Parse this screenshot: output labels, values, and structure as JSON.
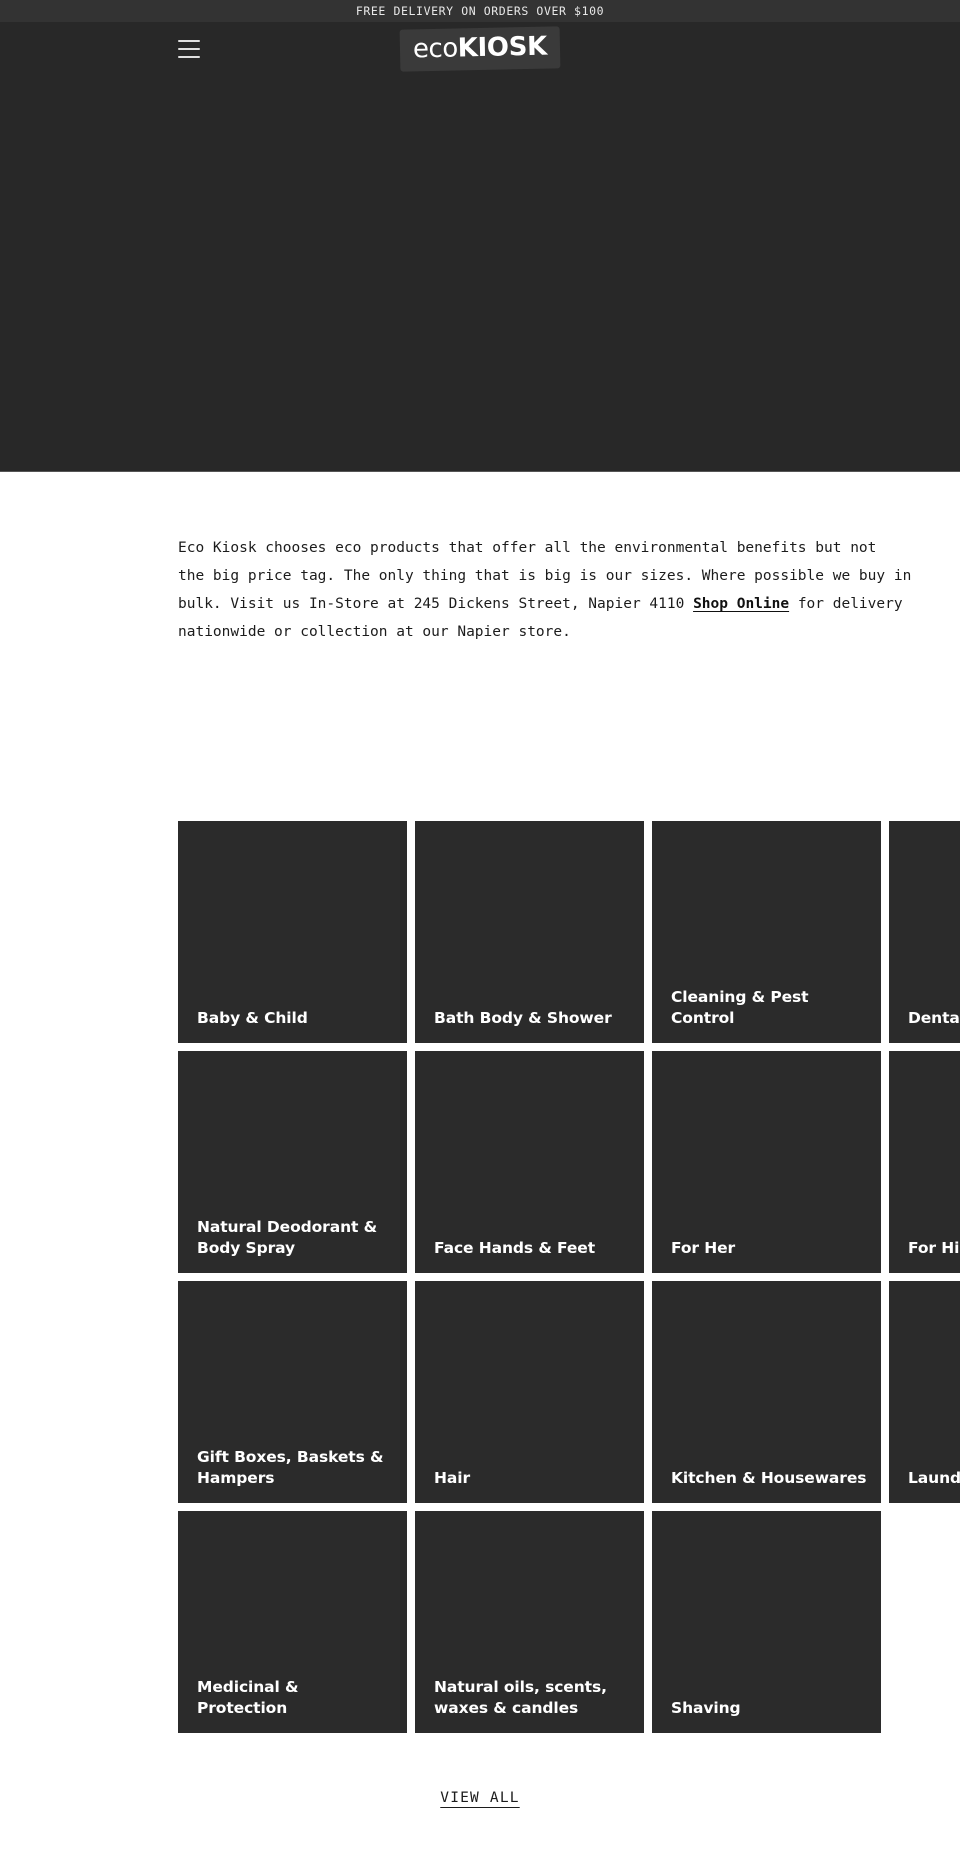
{
  "announcement": {
    "text": "FREE DELIVERY ON ORDERS OVER $100"
  },
  "header": {
    "menu_icon": "hamburger-menu-icon",
    "logo": {
      "part1": "eco",
      "part2": "KIOSK"
    }
  },
  "intro": {
    "line1": "Eco Kiosk chooses eco products that offer all the environmental benefits but not",
    "line2": "the big price tag. The only thing that is big is our sizes. Where possible we buy in",
    "line3_a": "bulk. Visit us In-Store at 245 Dickens Street, Napier 4110 ",
    "link": "Shop Online",
    "line3_b": " for delivery",
    "line4": "nationwide or collection at our Napier store."
  },
  "categories": [
    {
      "label": "Baby & Child"
    },
    {
      "label": "Bath Body & Shower"
    },
    {
      "label": "Cleaning & Pest Control"
    },
    {
      "label": "Dental Care"
    },
    {
      "label": "Natural Deodorant & Body Spray"
    },
    {
      "label": "Face Hands & Feet"
    },
    {
      "label": "For Her"
    },
    {
      "label": "For Him"
    },
    {
      "label": "Gift Boxes, Baskets & Hampers"
    },
    {
      "label": "Hair"
    },
    {
      "label": "Kitchen & Housewares"
    },
    {
      "label": "Laundry"
    },
    {
      "label": "Medicinal & Protection"
    },
    {
      "label": "Natural oils, scents, waxes & candles"
    },
    {
      "label": "Shaving"
    }
  ],
  "footer": {
    "view_all": "VIEW ALL"
  },
  "colors": {
    "announce_bg": "#333333",
    "header_bg": "#282828",
    "hero_bg": "#282828",
    "tile_bg": "#2b2b2b",
    "page_bg": "#ffffff",
    "text_dark": "#1c1c1c",
    "text_light": "#ffffff"
  }
}
